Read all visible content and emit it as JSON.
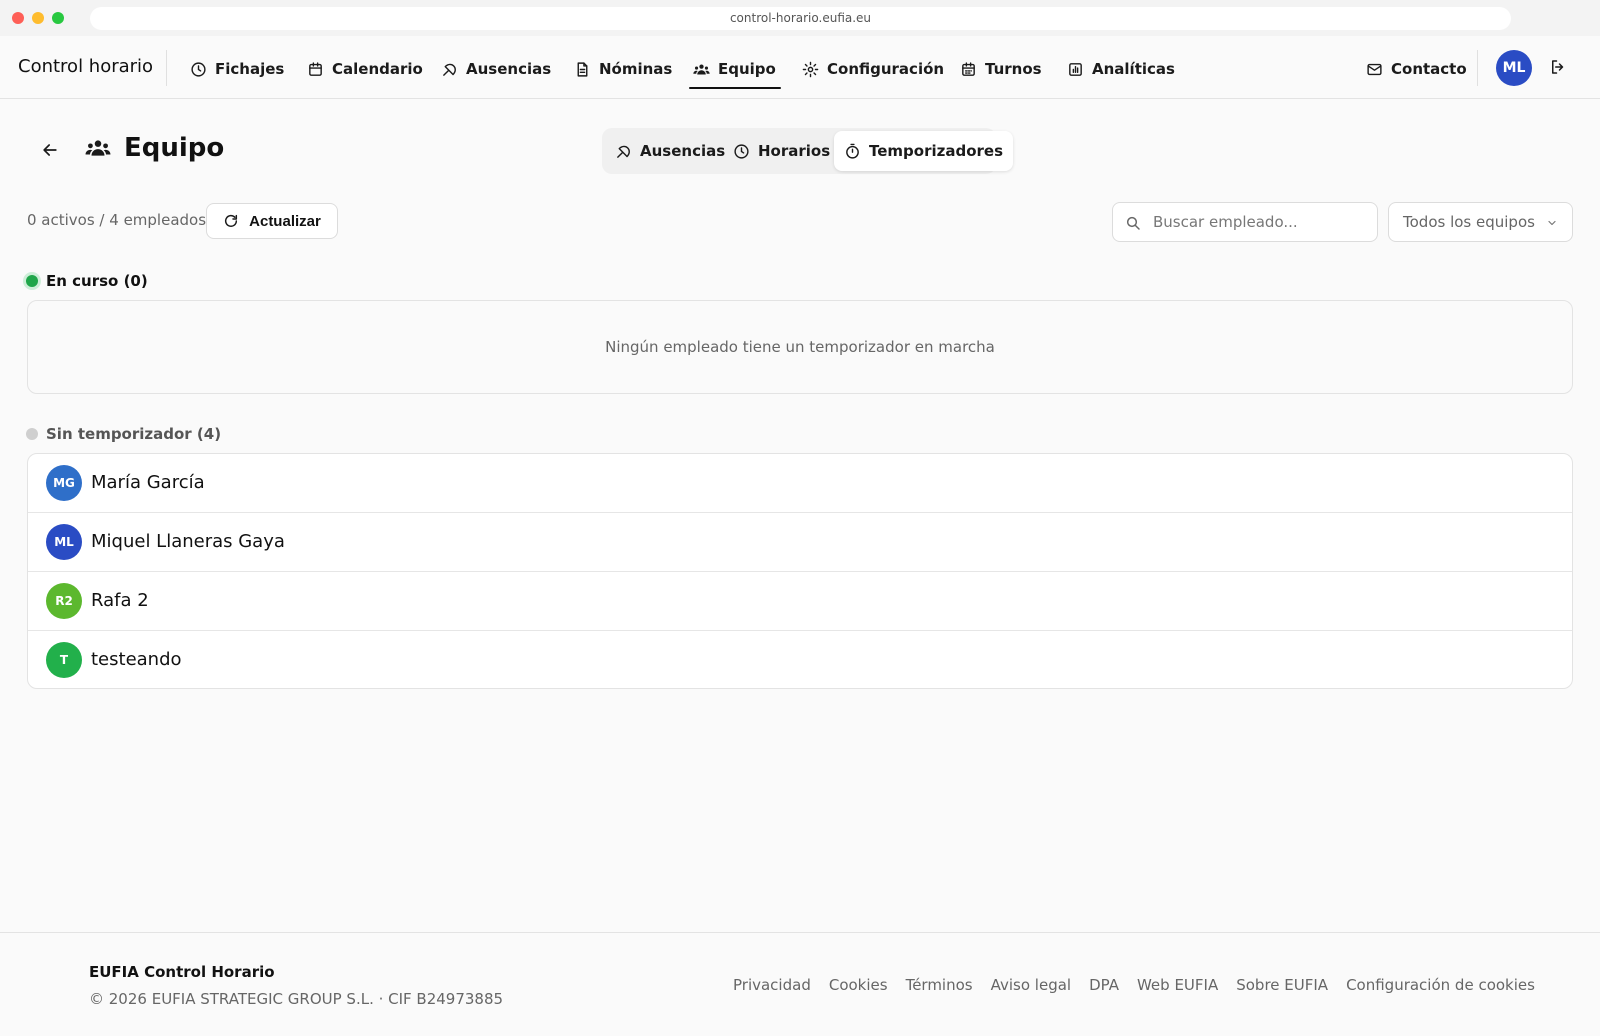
{
  "browser": {
    "url": "control-horario.eufia.eu"
  },
  "nav": {
    "brand": "Control horario",
    "items": [
      {
        "label": "Fichajes",
        "icon": "clock-icon"
      },
      {
        "label": "Calendario",
        "icon": "calendar-icon"
      },
      {
        "label": "Ausencias",
        "icon": "plane-icon"
      },
      {
        "label": "Nóminas",
        "icon": "document-icon"
      },
      {
        "label": "Equipo",
        "icon": "team-icon",
        "active": true
      },
      {
        "label": "Configuración",
        "icon": "gear-icon"
      },
      {
        "label": "Turnos",
        "icon": "calendar-icon"
      },
      {
        "label": "Analíticas",
        "icon": "chart-icon"
      }
    ],
    "contact": "Contacto",
    "user_initials": "ML"
  },
  "page": {
    "title": "Equipo",
    "tabs": [
      {
        "label": "Ausencias",
        "icon": "plane-icon"
      },
      {
        "label": "Horarios",
        "icon": "clock-icon"
      },
      {
        "label": "Temporizadores",
        "icon": "stopwatch-icon",
        "active": true
      }
    ]
  },
  "toolbar": {
    "counts": "0 activos / 4 empleados",
    "refresh_label": "Actualizar",
    "search_placeholder": "Buscar empleado...",
    "team_filter": "Todos los equipos"
  },
  "sections": {
    "running": {
      "title": "En curso (0)",
      "empty_message": "Ningún empleado tiene un temporizador en marcha"
    },
    "idle": {
      "title": "Sin temporizador (4)",
      "employees": [
        {
          "initials": "MG",
          "name": "María García",
          "color": "#2f6fc9"
        },
        {
          "initials": "ML",
          "name": "Miquel Llaneras Gaya",
          "color": "#2a4cc4"
        },
        {
          "initials": "R2",
          "name": "Rafa 2",
          "color": "#5cb82e"
        },
        {
          "initials": "T",
          "name": "testeando",
          "color": "#22b04b"
        }
      ]
    }
  },
  "footer": {
    "brand": "EUFIA Control Horario",
    "copyright": "© 2026 EUFIA STRATEGIC GROUP S.L. · CIF B24973885",
    "links": [
      "Privacidad",
      "Cookies",
      "Términos",
      "Aviso legal",
      "DPA",
      "Web EUFIA",
      "Sobre EUFIA",
      "Configuración de cookies"
    ]
  },
  "colors": {
    "accent_avatar": "#2a4cc4",
    "running_dot": "#1fa64a",
    "idle_dot": "#cfcfcf"
  }
}
